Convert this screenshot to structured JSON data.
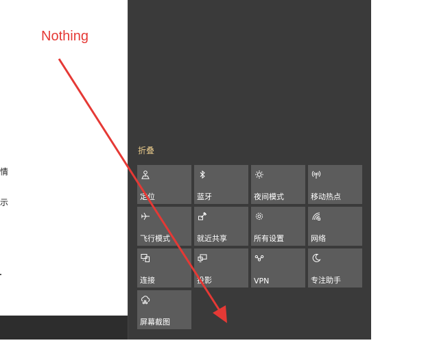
{
  "annotation": {
    "text": "Nothing",
    "color": "#e53935"
  },
  "left_panel": {
    "fragment_1": "情",
    "fragment_2": "示"
  },
  "action_center": {
    "collapse_label": "折叠",
    "tiles": [
      {
        "label": "定位",
        "icon": "location-icon"
      },
      {
        "label": "蓝牙",
        "icon": "bluetooth-icon"
      },
      {
        "label": "夜间模式",
        "icon": "night-light-icon"
      },
      {
        "label": "移动热点",
        "icon": "mobile-hotspot-icon"
      },
      {
        "label": "飞行模式",
        "icon": "airplane-icon"
      },
      {
        "label": "就近共享",
        "icon": "nearby-share-icon"
      },
      {
        "label": "所有设置",
        "icon": "settings-icon"
      },
      {
        "label": "网络",
        "icon": "network-icon"
      },
      {
        "label": "连接",
        "icon": "connect-icon"
      },
      {
        "label": "投影",
        "icon": "project-icon"
      },
      {
        "label": "VPN",
        "icon": "vpn-icon"
      },
      {
        "label": "专注助手",
        "icon": "focus-assist-icon"
      },
      {
        "label": "屏幕截图",
        "icon": "screen-snip-icon"
      }
    ]
  },
  "colors": {
    "panel_bg": "#3a3a3a",
    "tile_bg": "#5c5c5c",
    "collapse_text": "#e8c98a",
    "taskbar": "#2d2d2d"
  }
}
